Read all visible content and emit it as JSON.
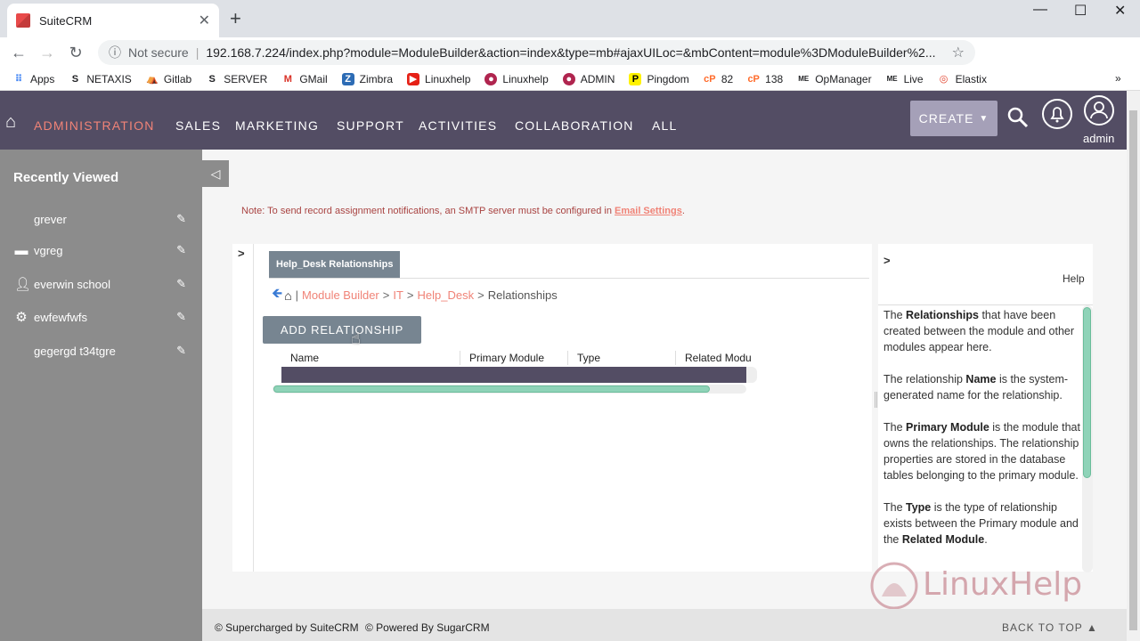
{
  "browser": {
    "tab_title": "SuiteCRM",
    "security_label": "Not secure",
    "url": "192.168.7.224/index.php?module=ModuleBuilder&action=index&type=mb#ajaxUILoc=&mbContent=module%3DModuleBuilder%2...",
    "bookmarks": [
      "Apps",
      "NETAXIS",
      "Gitlab",
      "SERVER",
      "GMail",
      "Zimbra",
      "Linuxhelp",
      "Linuxhelp",
      "ADMIN",
      "Pingdom",
      "82",
      "138",
      "OpManager",
      "Live",
      "Elastix"
    ]
  },
  "nav": {
    "items": [
      "ADMINISTRATION",
      "SALES",
      "MARKETING",
      "SUPPORT",
      "ACTIVITIES",
      "COLLABORATION",
      "ALL"
    ],
    "create_label": "CREATE",
    "user": "admin"
  },
  "sidebar": {
    "heading": "Recently Viewed",
    "items": [
      {
        "label": "grever",
        "icon": "none"
      },
      {
        "label": "vgreg",
        "icon": "folder-icon"
      },
      {
        "label": "everwin school",
        "icon": "user-icon"
      },
      {
        "label": "ewfewfwfs",
        "icon": "gear-icon"
      },
      {
        "label": "gegergd t34tgre",
        "icon": "none"
      }
    ]
  },
  "notice": {
    "text": "Note: To send record assignment notifications, an SMTP server must be configured in ",
    "link": "Email Settings",
    "tail": "."
  },
  "panel": {
    "tab_label": "Help_Desk Relationships",
    "breadcrumb": [
      "Module Builder",
      "IT",
      "Help_Desk",
      "Relationships"
    ],
    "add_button": "ADD RELATIONSHIP",
    "columns": [
      "Name",
      "Primary Module",
      "Type",
      "Related Modu"
    ]
  },
  "help": {
    "title": "Help",
    "p1_a": "The ",
    "p1_b": "Relationships",
    "p1_c": " that have been created between the module and other modules appear here.",
    "p2_a": "The relationship ",
    "p2_b": "Name",
    "p2_c": " is the system-generated name for the relationship.",
    "p3_a": "The ",
    "p3_b": "Primary Module",
    "p3_c": " is the module that owns the relationships. The relationship properties are stored in the database tables belonging to the primary module.",
    "p4_a": "The ",
    "p4_b": "Type",
    "p4_c": " is the type of relationship exists between the Primary module and the ",
    "p4_d": "Related Module",
    "p4_e": "."
  },
  "watermark": "LinuxHelp",
  "footer": {
    "supercharged": "© Supercharged by SuiteCRM",
    "powered": "© Powered By SugarCRM",
    "back_to_top": "BACK TO TOP"
  }
}
